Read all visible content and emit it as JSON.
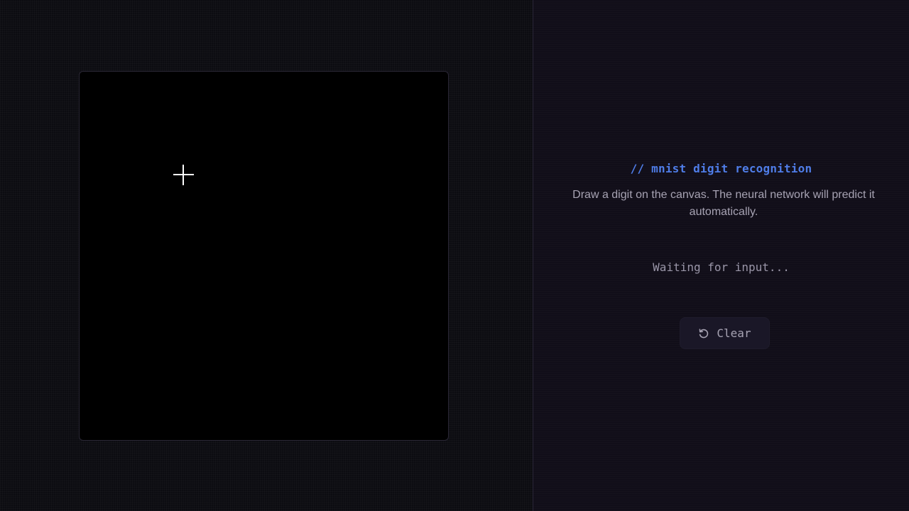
{
  "workspace": {
    "canvas_name": "drawing-canvas"
  },
  "panel": {
    "heading": "// mnist digit recognition",
    "description": "Draw a digit on the canvas. The neural network will predict it automatically.",
    "status": "Waiting for input...",
    "clear_button": {
      "label": "Clear",
      "icon": "reset-icon"
    }
  },
  "colors": {
    "accent": "#4f7de8",
    "canvas_bg": "#000000",
    "panel_bg": "#110e19",
    "text_muted": "#a7a3b3"
  }
}
